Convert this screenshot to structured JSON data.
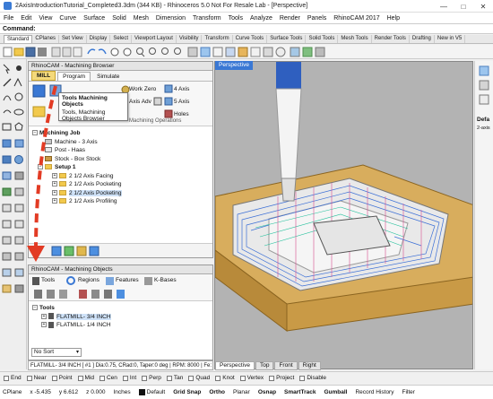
{
  "window": {
    "title": "2AxisIntroductionTutorial_Completed3.3dm (344 KB) - Rhinoceros 5.0 Not For Resale Lab - [Perspective]",
    "controls": [
      "—",
      "□",
      "✕"
    ]
  },
  "menu": [
    "File",
    "Edit",
    "View",
    "Curve",
    "Surface",
    "Solid",
    "Mesh",
    "Dimension",
    "Transform",
    "Tools",
    "Analyze",
    "Render",
    "Panels",
    "RhinoCAM 2017",
    "Help"
  ],
  "command": {
    "label": "Command:",
    "value": ""
  },
  "toolbar_tabs": [
    "Standard",
    "CPlanes",
    "Set View",
    "Display",
    "Select",
    "Viewport Layout",
    "Visibility",
    "Transform",
    "Curve Tools",
    "Surface Tools",
    "Solid Tools",
    "Mesh Tools",
    "Render Tools",
    "Drafting",
    "New in V5"
  ],
  "browser": {
    "header": "RhinoCAM     - Machining Browser",
    "tabs": [
      "MILL",
      "Program",
      "Simulate"
    ],
    "ribbon": [
      "Work Zero",
      "4 Axis",
      "5 Axis",
      "Axis Adv",
      "Holes"
    ],
    "section_label": "Machining Operations",
    "tree": {
      "root": "Machining Job",
      "items": [
        "Machine - 3 Axis",
        "Post - Haas",
        "Stock - Box Stock"
      ],
      "setup": "Setup 1",
      "ops": [
        "2 1/2 Axis Facing",
        "2 1/2 Axis Pocketing",
        "2 1/2 Axis Pocketing",
        "2 1/2 Axis Profiling"
      ]
    }
  },
  "tooltip": {
    "title": "Tools  Machining Objects",
    "body": "Tools, Machining Objects Browser"
  },
  "objects": {
    "header": "RhinoCAM     - Machining Objects",
    "tabs": [
      "Tools",
      "Regions",
      "Features",
      "K-Bases"
    ],
    "tree_root": "Tools",
    "tools": [
      "FLATMILL- 3/4 INCH",
      "FLATMILL- 1/4 INCH"
    ],
    "sort": "No Sort",
    "status_line": "FLATMILL- 3/4 INCH [ #1 ] Dia:0.75, CRad:0, Taper:0 deg | RPM: 8000 | Fe: 60"
  },
  "viewport": {
    "label": "Perspective",
    "bottom_tabs": [
      "Perspective",
      "Top",
      "Front",
      "Right"
    ]
  },
  "right_panel": {
    "label": "Defa",
    "sub": "2-axis"
  },
  "osnap": [
    "End",
    "Near",
    "Point",
    "Mid",
    "Cen",
    "Int",
    "Perp",
    "Tan",
    "Quad",
    "Knot",
    "Vertex",
    "Project",
    "Disable"
  ],
  "status": {
    "cplane": "CPlane",
    "x": "x -5.435",
    "y": "y 6.612",
    "z": "z 0.000",
    "units": "Inches",
    "layer": "Default",
    "toggles": [
      "Grid Snap",
      "Ortho",
      "Planar",
      "Osnap",
      "SmartTrack",
      "Gumball",
      "Record History",
      "Filter"
    ]
  },
  "colors": {
    "accent": "#3a78d4",
    "arrow": "#e23b24",
    "stock": "#c99a46",
    "tool": "#4d8fe0"
  }
}
